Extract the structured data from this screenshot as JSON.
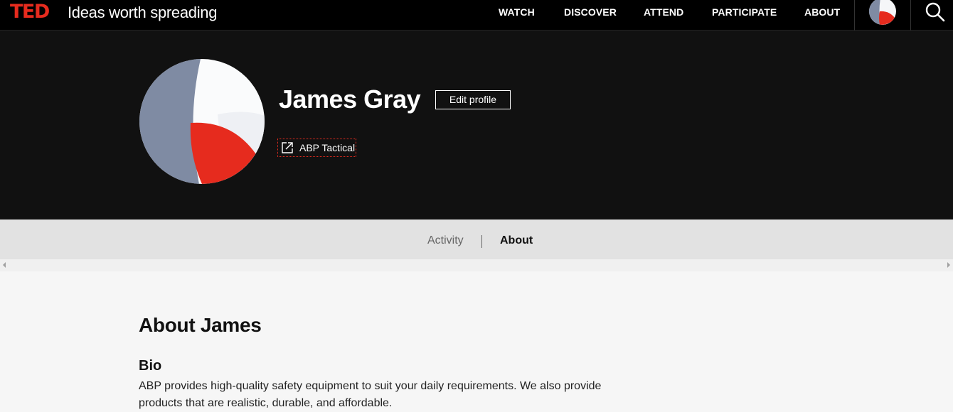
{
  "topnav": {
    "logo": "TED",
    "tagline": "Ideas worth spreading",
    "links": [
      "WATCH",
      "DISCOVER",
      "ATTEND",
      "PARTICIPATE",
      "ABOUT"
    ]
  },
  "profile": {
    "name": "James Gray",
    "edit_label": "Edit profile",
    "website_label": "ABP Tactical"
  },
  "tabs": {
    "activity": "Activity",
    "about": "About"
  },
  "about": {
    "title": "About James",
    "bio_heading": "Bio",
    "bio_text": "ABP provides high-quality safety equipment to suit your daily requirements. We also provide products that are realistic, durable, and affordable."
  },
  "colors": {
    "brand_red": "#e62b1e",
    "nav_bg": "#000000",
    "header_bg": "#111111",
    "tabbar_bg": "#e2e2e2",
    "avatar_grey": "#7f8ba3",
    "avatar_white": "#f5f6f8"
  },
  "icons": {
    "search": "search-icon",
    "external_link": "external-link-icon",
    "avatar": "avatar-image"
  }
}
